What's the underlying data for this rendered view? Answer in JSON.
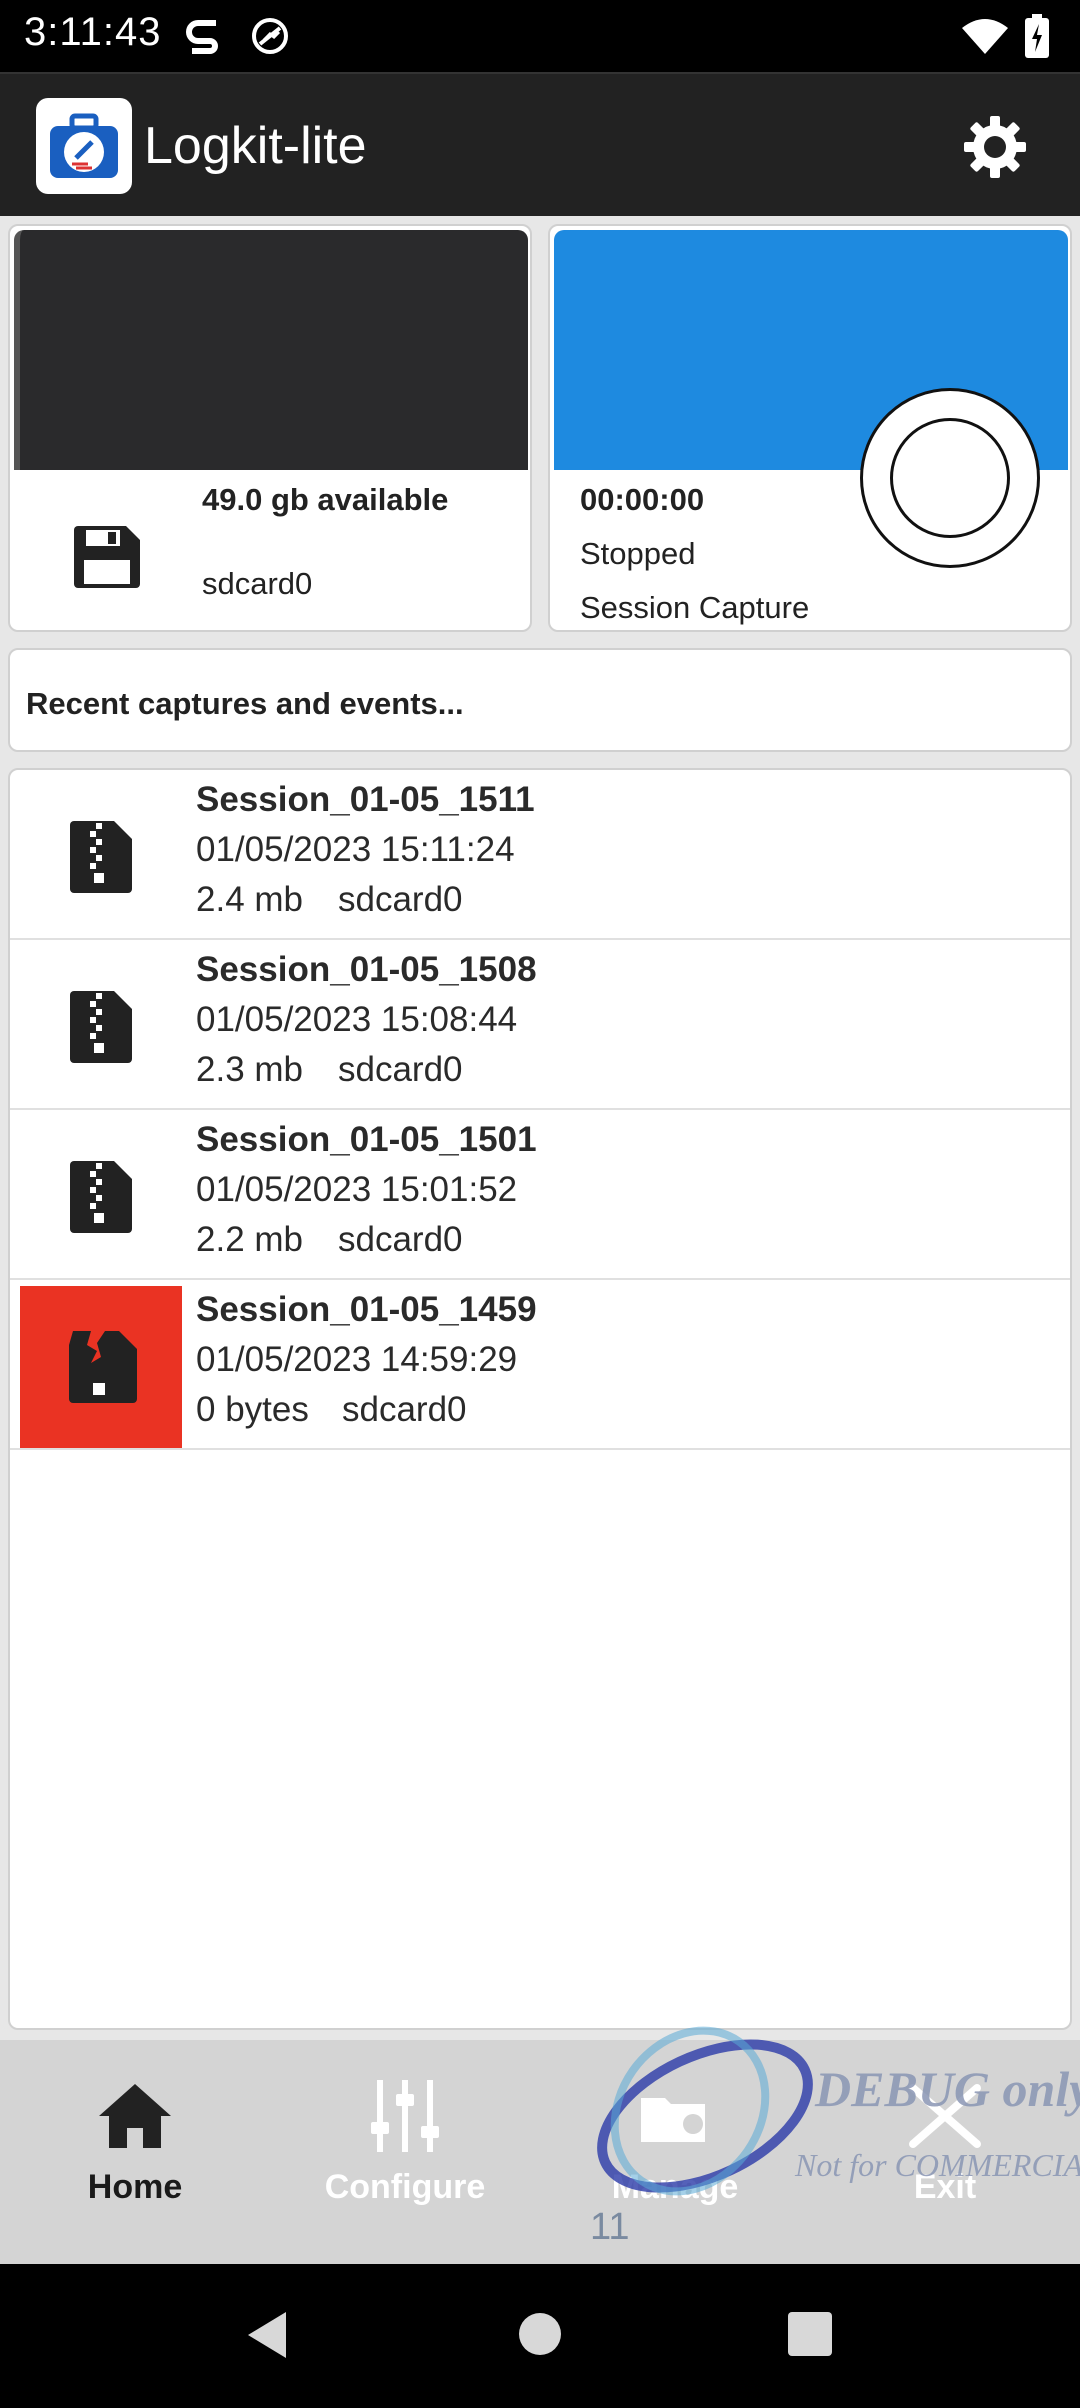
{
  "status_bar": {
    "time": "3:11:43",
    "signal_badge": "5"
  },
  "app_bar": {
    "title": "Logkit-lite",
    "settings_icon": "gear-icon"
  },
  "storage": {
    "available": "49.0 gb available",
    "device": "sdcard0"
  },
  "capture": {
    "timer": "00:00:00",
    "state": "Stopped",
    "label": "Session Capture"
  },
  "recent": {
    "header": "Recent captures and events..."
  },
  "sessions": [
    {
      "name": "Session_01-05_1511",
      "datetime": "01/05/2023 15:11:24",
      "size": "2.4 mb",
      "location": "sdcard0",
      "status": "ok"
    },
    {
      "name": "Session_01-05_1508",
      "datetime": "01/05/2023 15:08:44",
      "size": "2.3 mb",
      "location": "sdcard0",
      "status": "ok"
    },
    {
      "name": "Session_01-05_1501",
      "datetime": "01/05/2023 15:01:52",
      "size": "2.2 mb",
      "location": "sdcard0",
      "status": "ok"
    },
    {
      "name": "Session_01-05_1459",
      "datetime": "01/05/2023 14:59:29",
      "size": "0 bytes",
      "location": "sdcard0",
      "status": "error"
    }
  ],
  "bottom_nav": {
    "home": "Home",
    "configure": "Configure",
    "manage": "Manage",
    "exit": "Exit"
  },
  "watermark": {
    "line1": "DEBUG only",
    "line2": "Not for COMMERCIAL",
    "count": "11"
  },
  "colors": {
    "capture_blue": "#1e8ae0",
    "error_red": "#ea3323",
    "app_bar": "#222222",
    "nav_bg": "#d4d4d4"
  }
}
